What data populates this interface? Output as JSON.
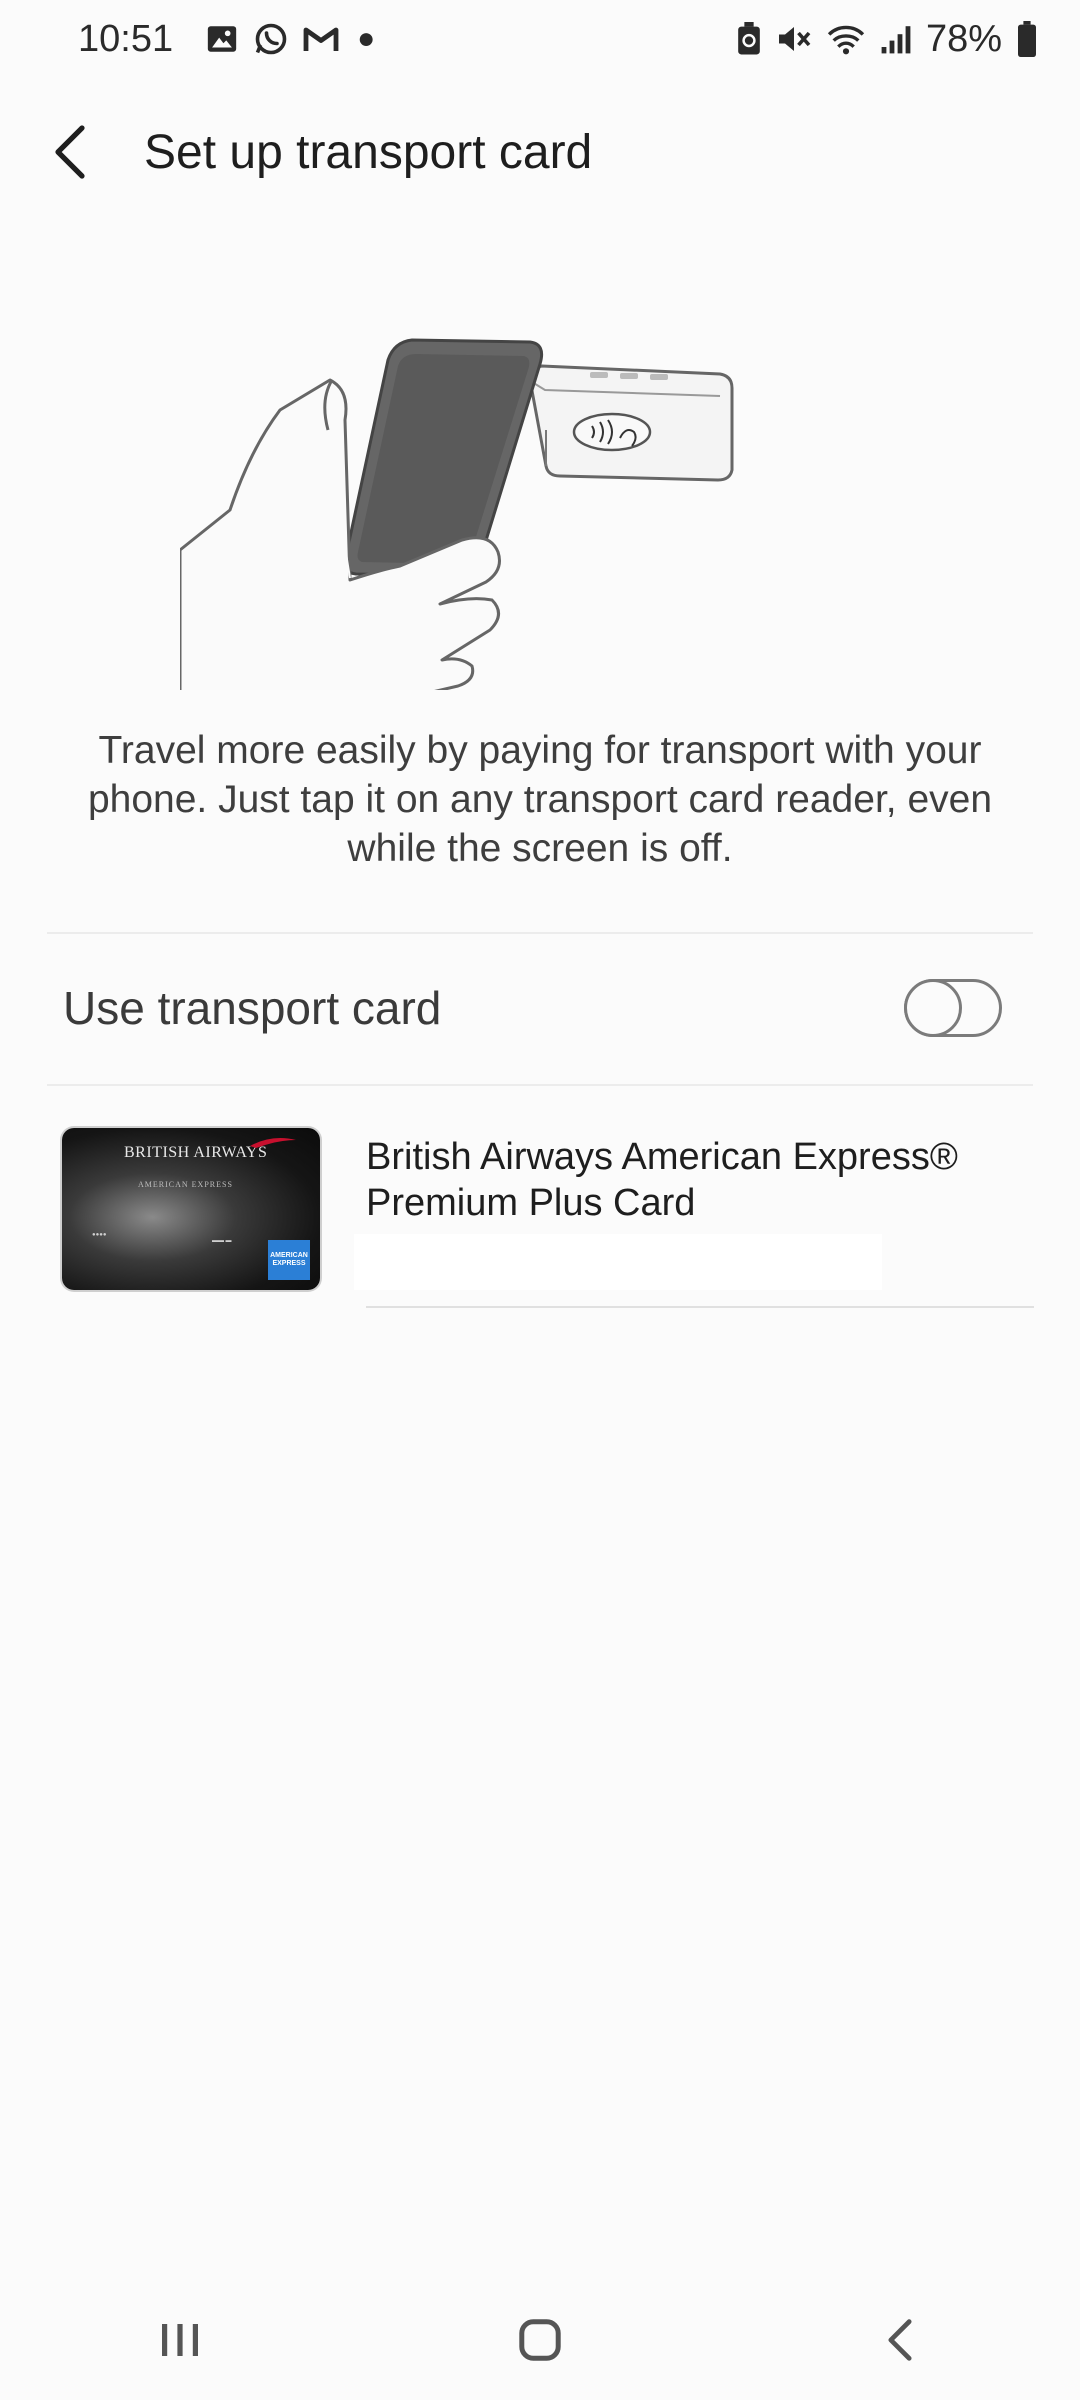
{
  "status_bar": {
    "time": "10:51",
    "left_icons": [
      "gallery-icon",
      "whatsapp-icon",
      "gmail-icon",
      "notification-dot-icon"
    ],
    "right_icons": [
      "battery-saver-icon",
      "mute-icon",
      "wifi-icon",
      "signal-icon",
      "battery-icon"
    ],
    "battery_percent": "78%"
  },
  "header": {
    "back_icon": "back-arrow-icon",
    "title": "Set up transport card"
  },
  "illustration": {
    "icon": "phone-tap-reader-illustration"
  },
  "description": {
    "text": "Travel more easily by paying for transport with your phone. Just tap it on any transport card reader, even while the screen is off."
  },
  "transport_toggle": {
    "label": "Use transport card",
    "enabled": false
  },
  "card": {
    "name": "British Airways American Express® Premium Plus Card",
    "image": {
      "brand": "BRITISH AIRWAYS",
      "sub_brand": "AMERICAN EXPRESS",
      "logo": "AMERICAN EXPRESS"
    }
  },
  "nav_bar": {
    "icons": [
      "recent-apps-icon",
      "home-icon",
      "back-icon"
    ]
  }
}
